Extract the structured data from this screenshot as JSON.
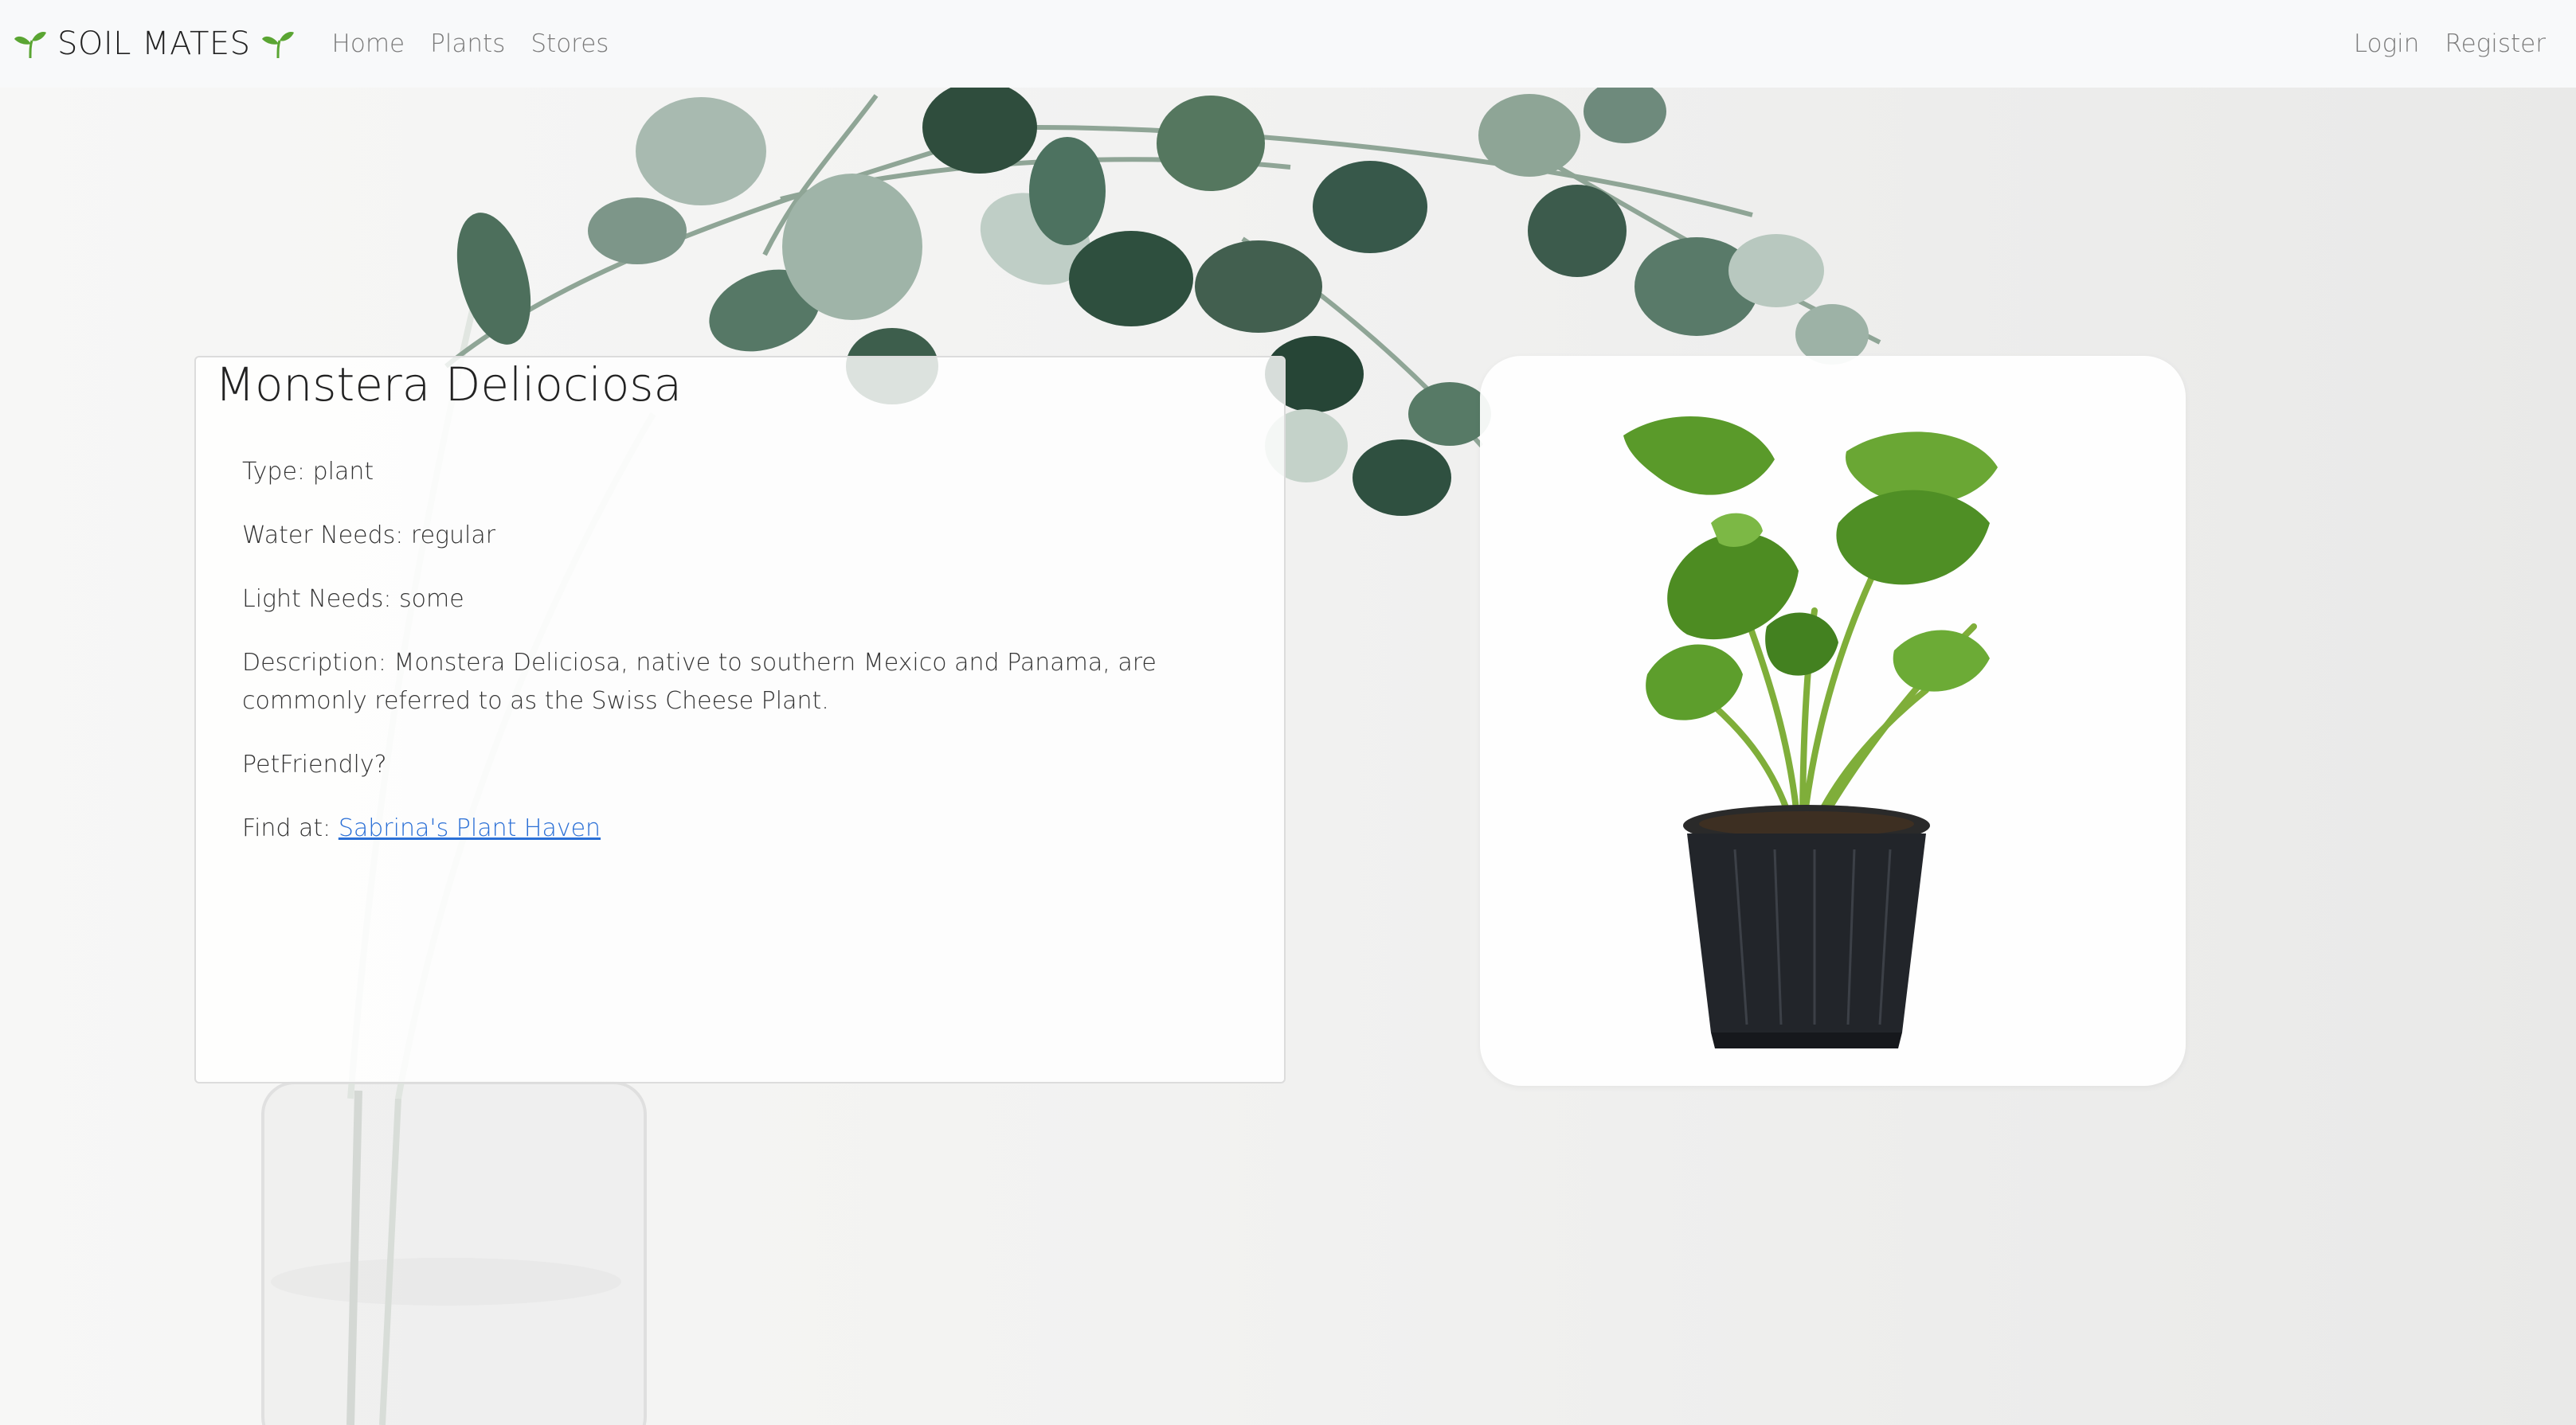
{
  "navbar": {
    "brand": "SOIL MATES",
    "links": [
      "Home",
      "Plants",
      "Stores"
    ],
    "right_links": [
      "Login",
      "Register"
    ],
    "accent_color": "#5aa532"
  },
  "plant": {
    "name": "Monstera Deliociosa",
    "type_label": "Type:",
    "type_value": "plant",
    "water_label": "Water Needs:",
    "water_value": "regular",
    "light_label": "Light Needs:",
    "light_value": "some",
    "description_label": "Description:",
    "description_value": "Monstera Deliciosa, native to southern Mexico and Panama, are commonly referred to as the Swiss Cheese Plant.",
    "pet_friendly_label": "PetFriendly?",
    "find_at_label": "Find at:",
    "store_name": "Sabrina's Plant Haven"
  }
}
